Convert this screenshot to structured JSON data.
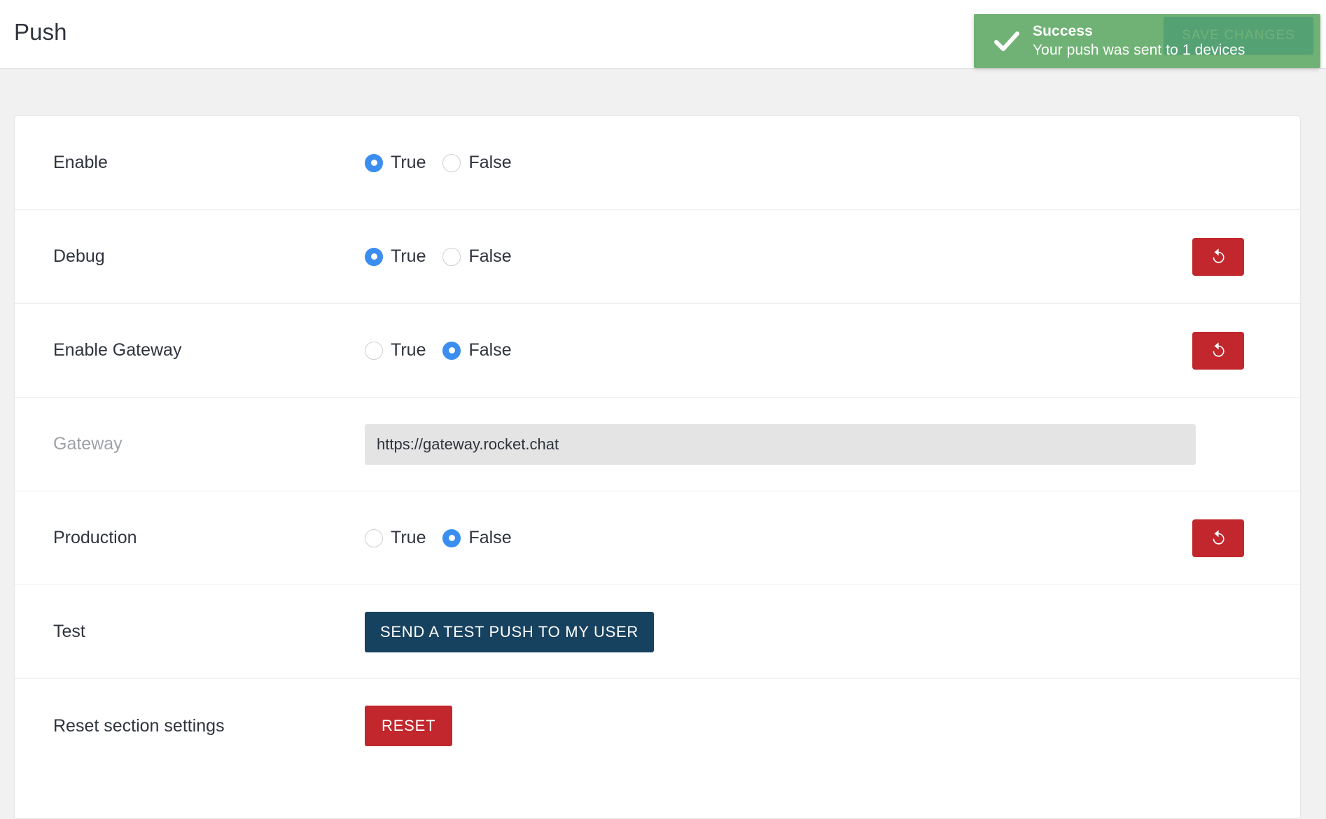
{
  "header": {
    "title": "Push",
    "save_label": "SAVE CHANGES"
  },
  "toast": {
    "icon": "check-icon",
    "title": "Success",
    "message": "Your push was sent to 1 devices",
    "color": "#5ca762"
  },
  "colors": {
    "accent_blue": "#3b8ef0",
    "danger_red": "#c1272d",
    "test_navy": "#17425f",
    "success_green": "#5ca762",
    "page_bg": "#f1f1f1"
  },
  "settings": [
    {
      "label": "Enable",
      "type": "radio",
      "options": [
        {
          "label": "True",
          "checked": true
        },
        {
          "label": "False",
          "checked": false
        }
      ],
      "has_revert": false,
      "disabled": false
    },
    {
      "label": "Debug",
      "type": "radio",
      "options": [
        {
          "label": "True",
          "checked": true
        },
        {
          "label": "False",
          "checked": false
        }
      ],
      "has_revert": true,
      "disabled": false
    },
    {
      "label": "Enable Gateway",
      "type": "radio",
      "options": [
        {
          "label": "True",
          "checked": false
        },
        {
          "label": "False",
          "checked": true
        }
      ],
      "has_revert": true,
      "disabled": false
    },
    {
      "label": "Gateway",
      "type": "text",
      "value": "https://gateway.rocket.chat",
      "has_revert": false,
      "disabled": true
    },
    {
      "label": "Production",
      "type": "radio",
      "options": [
        {
          "label": "True",
          "checked": false
        },
        {
          "label": "False",
          "checked": true
        }
      ],
      "has_revert": true,
      "disabled": false
    },
    {
      "label": "Test",
      "type": "button",
      "button_label": "SEND A TEST PUSH TO MY USER",
      "button_style": "navy",
      "has_revert": false,
      "disabled": false
    },
    {
      "label": "Reset section settings",
      "type": "button",
      "button_label": "RESET",
      "button_style": "red",
      "has_revert": false,
      "disabled": false
    }
  ],
  "icons": {
    "revert": "undo-arrow-icon"
  }
}
